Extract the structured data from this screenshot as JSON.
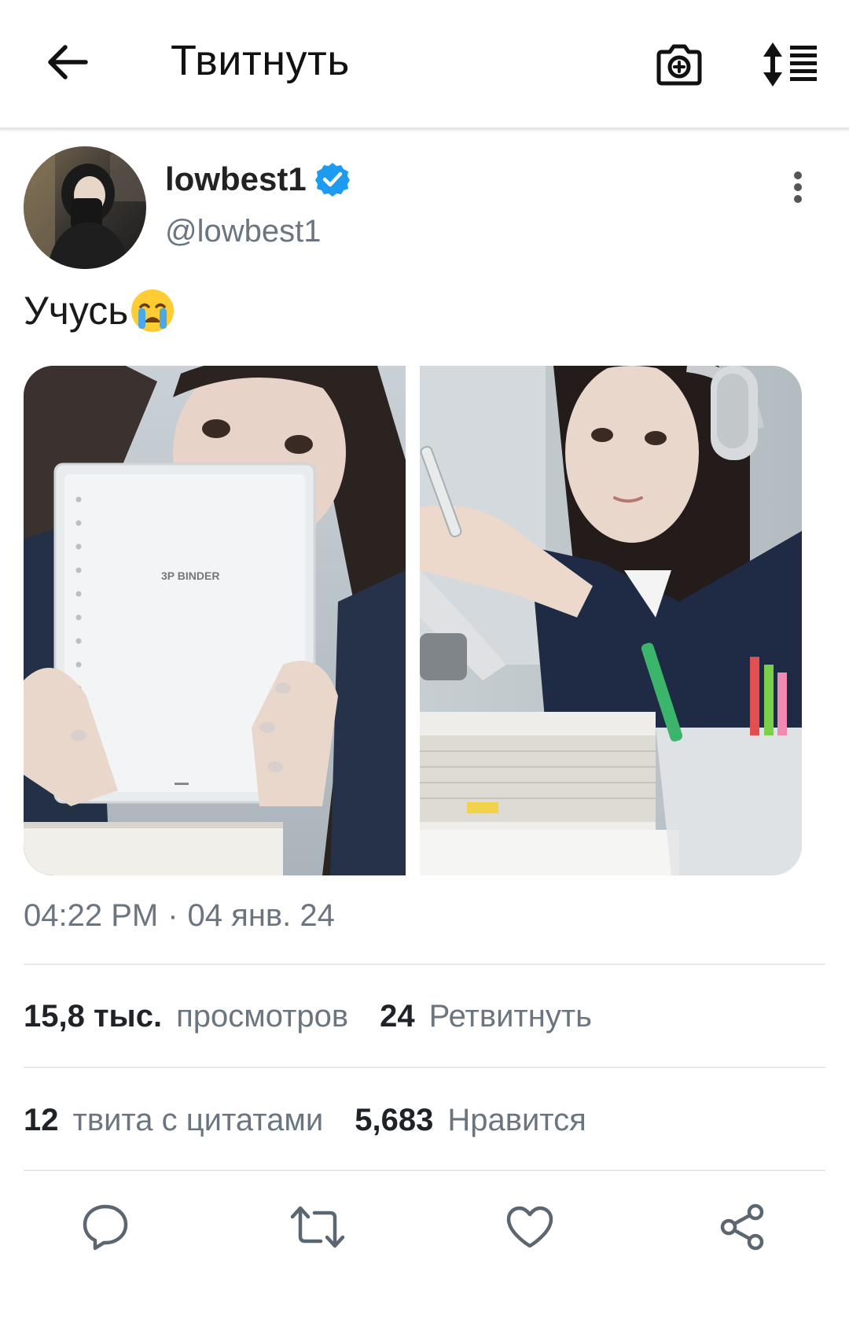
{
  "header": {
    "title": "Твитнуть",
    "back_icon": "arrow-left-icon",
    "camera_icon": "camera-add-icon",
    "sort_icon": "sort-list-icon"
  },
  "tweet": {
    "author": {
      "display_name": "lowbest1",
      "handle": "@lowbest1",
      "verified": true
    },
    "text": "Учусь",
    "emoji": "😭",
    "media": [
      {
        "alt": "photo-binder"
      },
      {
        "alt": "photo-headphones"
      }
    ],
    "time": "04:22 PM",
    "separator": "·",
    "date": "04 янв. 24"
  },
  "stats": {
    "views_count": "15,8 тыс.",
    "views_label": "просмотров",
    "retweets_count": "24",
    "retweets_label": "Ретвитнуть",
    "quotes_count": "12",
    "quotes_label": "твита с цитатами",
    "likes_count": "5,683",
    "likes_label": "Нравится"
  },
  "actions": {
    "reply_icon": "reply-bubble-icon",
    "retweet_icon": "retweet-icon",
    "like_icon": "heart-icon",
    "share_icon": "share-icon"
  },
  "colors": {
    "verified_blue": "#1d9bf0",
    "muted_text": "#6b7580",
    "divider": "#e6e9ec",
    "icon_gray": "#5b6670"
  }
}
